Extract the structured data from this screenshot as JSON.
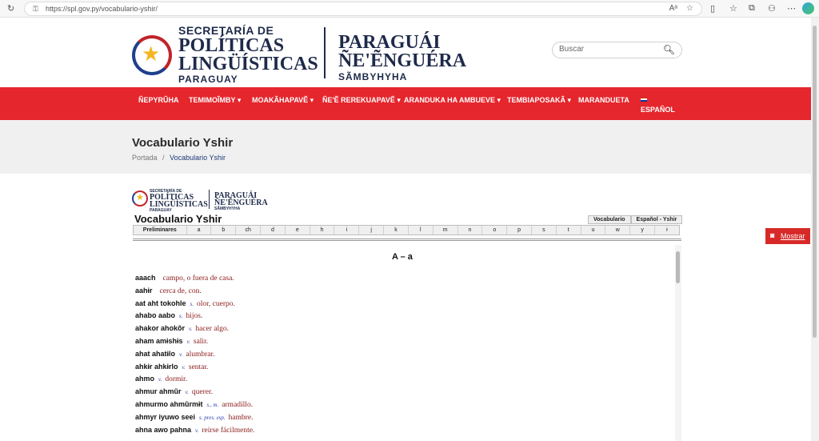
{
  "browser": {
    "url": "https://spl.gov.py/vocabulario-yshir/",
    "icons": [
      "back-icon",
      "refresh-icon",
      "lock-icon",
      "read-aloud-icon",
      "favorite-icon",
      "split-screen-icon",
      "favorites-icon",
      "collections-icon",
      "extensions-icon",
      "more-icon",
      "copilot-icon"
    ]
  },
  "header": {
    "es_line1": "SECRETARÍA DE",
    "es_line2": "POLÍTICAS",
    "es_line3": "LINGÜÍSTICAS",
    "es_line4": "PARAGUAY",
    "gn_line1": "PARAGUÁI",
    "gn_line2": "ÑE'ẼNGUÉRA",
    "gn_line3": "SÃMBYHYHA",
    "search_placeholder": "Buscar"
  },
  "menu": [
    {
      "label": "ÑEPYRŨHA"
    },
    {
      "label": "TEMIMOĨMBY ▾"
    },
    {
      "label": "MOAKÃHAPAVẼ ▾"
    },
    {
      "label": "ÑE'Ẽ REREKUAPAVẼ ▾"
    },
    {
      "label": "ARANDUKA HA AMBUEVE ▾"
    },
    {
      "label": "TEMBIAPOSAKÃ ▾"
    },
    {
      "label": "MARANDUETA"
    },
    {
      "label": "ESPAÑOL"
    }
  ],
  "page": {
    "title": "Vocabulario Yshir",
    "breadcrumb_home": "Portada",
    "breadcrumb_sep": "/",
    "breadcrumb_current": "Vocabulario Yshir"
  },
  "doc": {
    "logo_es1": "SECRETARÍA DE",
    "logo_es2": "POLÍTICAS",
    "logo_es3": "LINGÜÍSTICAS",
    "logo_es4": "PARAGUAY",
    "logo_gn1": "PARAGUÁI",
    "logo_gn2": "ÑE'ẼNGUÉRA",
    "logo_gn3": "SÃMBYHYHA",
    "title": "Vocabulario Yshir",
    "tab_vocab": "Vocabulario",
    "tab_es": "Español - Yshir",
    "alphabet": [
      "Preliminares",
      "a",
      "b",
      "ch",
      "d",
      "e",
      "h",
      "i",
      "j",
      "k",
      "l",
      "m",
      "n",
      "o",
      "p",
      "s",
      "t",
      "u",
      "w",
      "y",
      "ɨ"
    ],
    "letter_heading": "A – a",
    "entries": [
      {
        "hw": "aaach",
        "pos": "",
        "def": "campo, o fuera de casa."
      },
      {
        "hw": "aahɨr",
        "pos": "",
        "def": "cerca de, con."
      },
      {
        "hw": "aat aht tokohle",
        "pos": "s.",
        "def": "olor, cuerpo."
      },
      {
        "hw": "ahabo aabo",
        "pos": "s.",
        "def": "hijos."
      },
      {
        "hw": "ahakor ahokõr",
        "pos": "v.",
        "def": "hacer algo."
      },
      {
        "hw": "aham amɨshɨs",
        "pos": "v.",
        "def": "salir."
      },
      {
        "hw": "ahat ahatɨlo",
        "pos": "v.",
        "def": "alumbrar."
      },
      {
        "hw": "ahkɨr ahkɨrlo",
        "pos": "v.",
        "def": "sentar."
      },
      {
        "hw": "ahmo",
        "pos": "v.",
        "def": "dormir."
      },
      {
        "hw": "ahmur ahmũr",
        "pos": "v.",
        "def": "querer."
      },
      {
        "hw": "ahmurmo ahmũrmɨt",
        "pos": "s., m.",
        "def": "armadillo."
      },
      {
        "hw": "ahmyr iyuwo seei",
        "pos": "s. pres. esp.",
        "def": "hambre."
      },
      {
        "hw": "ahna awo pahna",
        "pos": "v.",
        "def": "reirse fácilmente."
      }
    ]
  },
  "side_button": {
    "label": "Mostrar"
  }
}
